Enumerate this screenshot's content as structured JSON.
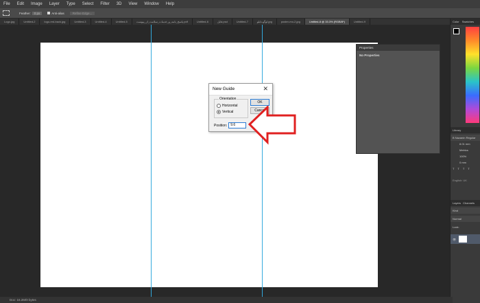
{
  "menubar": {
    "items": [
      "File",
      "Edit",
      "Image",
      "Layer",
      "Type",
      "Select",
      "Filter",
      "3D",
      "View",
      "Window",
      "Help"
    ]
  },
  "optbar": {
    "feather_label": "Feather:",
    "feather_value": "0 px",
    "antialias_label": "Anti-alias",
    "refine_label": "Refine Edge..."
  },
  "tabs": [
    "Logo.jpg",
    "Untitled-2",
    "logo-red-back.jpg",
    "Untitled-3",
    "Untitled-4",
    "Untitled-5",
    "پاسخ_نامه_و_خدمات_سلامت_از_پیوست.pdf",
    "Untitled-6",
    "فایل.psd",
    "Untitled-7",
    "لوگو-تابلو.jpg",
    "poster-mo-2.jpg",
    "Untitled-8 @ 33.3% (RGB/8*)",
    "Untitled-9"
  ],
  "active_tab_index": 12,
  "properties": {
    "title": "Properties",
    "body": "No Properties"
  },
  "dialog": {
    "title": "New Guide",
    "orientation_label": "Orientation",
    "horizontal_label": "Horizontal",
    "vertical_label": "Vertical",
    "selected": "Vertical",
    "ok_label": "OK",
    "cancel_label": "Cancel",
    "position_label": "Position:",
    "position_value": "9.6"
  },
  "status": {
    "text": "Doc: 16.2M/0 bytes"
  },
  "right_panel": {
    "color_tab": "Color",
    "swatches_tab": "Swatches",
    "char_tab": "Library",
    "font_name": "B Nazanin Regular",
    "size_value": "8.01 mm",
    "tracking_value": "Metrics",
    "scale_value": "100%",
    "baseline_value": "0 mm",
    "language_value": "English: UK",
    "layers_tab": "Layers",
    "channels_tab": "Channels",
    "kind_label": "Kind",
    "blend_value": "Normal",
    "lock_label": "Lock:"
  },
  "colors": {
    "guide": "#33aadd",
    "arrow": "#e02020",
    "accent": "#2a7bd4"
  }
}
